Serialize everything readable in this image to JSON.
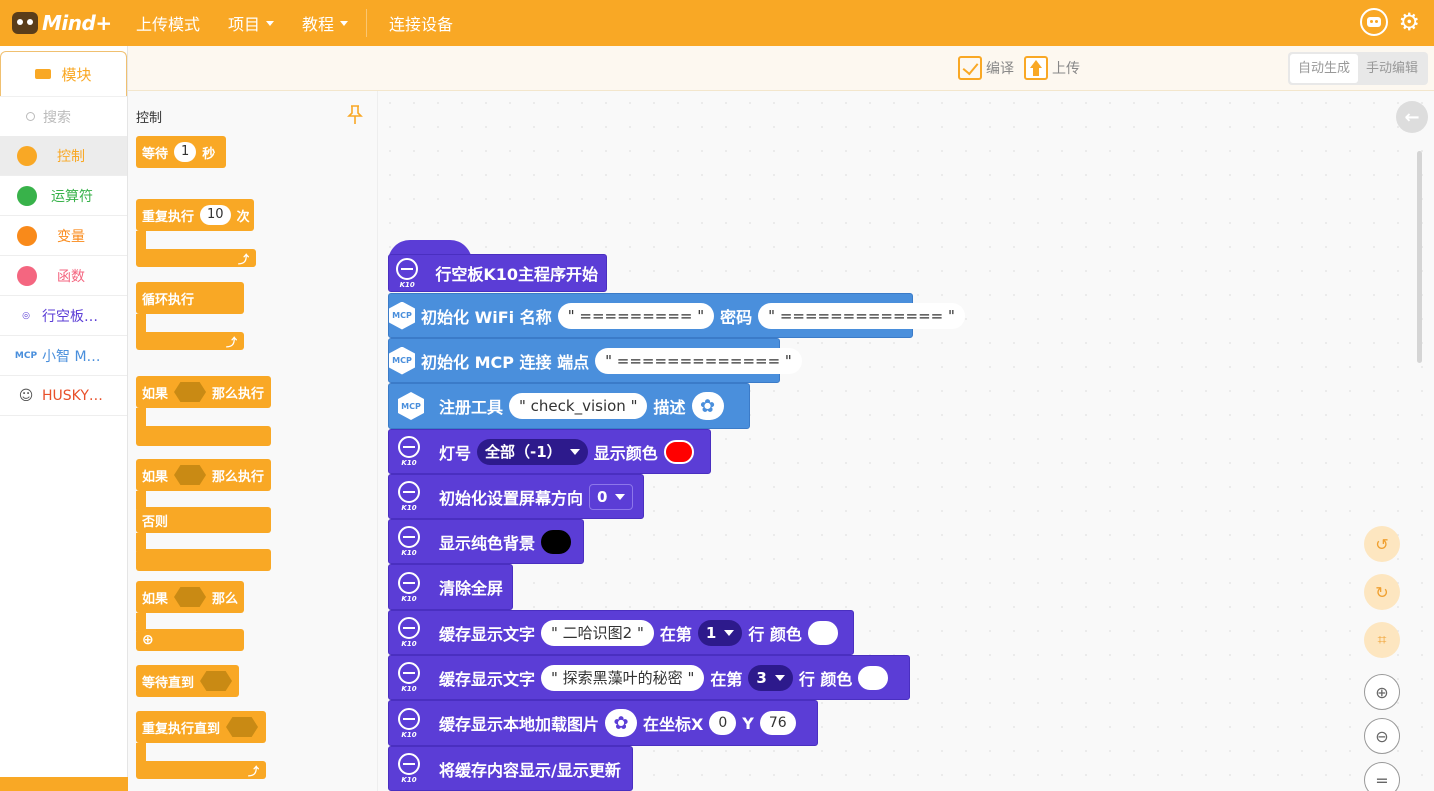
{
  "app": {
    "logo_text": "Mind+",
    "nav": [
      {
        "label": "上传模式"
      },
      {
        "label": "项目"
      },
      {
        "label": "教程"
      },
      {
        "label": "连接设备"
      }
    ],
    "icons": {
      "robot": "robot-icon",
      "settings": "gear-icon"
    }
  },
  "sidebar": {
    "tab_label": "模块",
    "search_placeholder": "搜索",
    "categories": [
      {
        "label": "控制",
        "color": "#f9a825"
      },
      {
        "label": "运算符",
        "color": "#38b24a"
      },
      {
        "label": "变量",
        "color": "#f98a1a"
      },
      {
        "label": "函数",
        "color": "#f46680"
      },
      {
        "label": "行空板…",
        "color": "#5b3dd6"
      },
      {
        "label": "小智 M…",
        "color": "#4a8fdc"
      },
      {
        "label": "HUSKY…",
        "color": "#e8502a"
      }
    ]
  },
  "flyout": {
    "title": "控制",
    "blocks": {
      "wait": {
        "label": "等待",
        "value": "1",
        "unit": "秒"
      },
      "repeat": {
        "label": "重复执行",
        "value": "10",
        "unit": "次"
      },
      "forever": {
        "label": "循环执行"
      },
      "if_then": {
        "if": "如果",
        "then": "那么执行"
      },
      "if_else": {
        "if": "如果",
        "then": "那么执行",
        "else": "否则"
      },
      "if_then2": {
        "if": "如果",
        "then": "那么"
      },
      "wait_until": {
        "label": "等待直到"
      },
      "repeat_until": {
        "label": "重复执行直到"
      }
    }
  },
  "toolbar": {
    "compile_label": "编译",
    "upload_label": "上传",
    "mode_auto": "自动生成",
    "mode_manual": "手动编辑"
  },
  "program": {
    "hat": "行空板K10主程序开始",
    "wifi": {
      "label": "初始化 WiFi 名称",
      "ssid": "\" ========= \"",
      "pwd_label": "密码",
      "pwd": "\" ============= \""
    },
    "mcp_init": {
      "label": "初始化 MCP 连接 端点",
      "endpoint": "\" ============= \""
    },
    "register": {
      "label": "注册工具",
      "name": "\" check_vision \"",
      "desc_label": "描述"
    },
    "led": {
      "label": "灯号",
      "value": "全部（-1）",
      "color_label": "显示颜色",
      "color": "#ff0000"
    },
    "orientation": {
      "label": "初始化设置屏幕方向",
      "value": "0"
    },
    "bg": {
      "label": "显示纯色背景",
      "color": "#000000"
    },
    "clear": {
      "label": "清除全屏"
    },
    "text1": {
      "label": "缓存显示文字",
      "text": "\" 二哈识图2 \"",
      "row_label": "在第",
      "row": "1",
      "row_suffix": "行 颜色",
      "color": "#ffffff"
    },
    "text2": {
      "label": "缓存显示文字",
      "text": "\" 探索黑藻叶的秘密 \"",
      "row_label": "在第",
      "row": "3",
      "row_suffix": "行 颜色",
      "color": "#ffffff"
    },
    "image": {
      "label": "缓存显示本地加载图片",
      "x_label": "在坐标X",
      "x": "0",
      "y_label": "Y",
      "y": "76"
    },
    "refresh": {
      "label": "将缓存内容显示/显示更新"
    }
  },
  "badges": {
    "k10": "K10",
    "mcp": "MCP"
  }
}
